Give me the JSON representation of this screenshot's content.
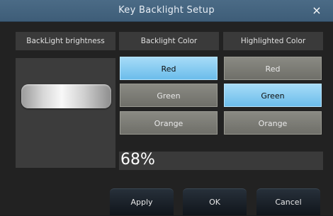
{
  "window": {
    "title": "Key Backlight Setup",
    "close_glyph": "×"
  },
  "columns": {
    "brightness": "BackLight brightness",
    "backlight_color": "Backlight Color",
    "highlighted_color": "Highlighted Color"
  },
  "brightness": {
    "percent_text": "68%",
    "value_percent": 68
  },
  "backlight_options": [
    {
      "label": "Red",
      "selected": true
    },
    {
      "label": "Green",
      "selected": false
    },
    {
      "label": "Orange",
      "selected": false
    }
  ],
  "highlighted_options": [
    {
      "label": "Red",
      "selected": false
    },
    {
      "label": "Green",
      "selected": true
    },
    {
      "label": "Orange",
      "selected": false
    }
  ],
  "buttons": {
    "apply": "Apply",
    "ok": "OK",
    "cancel": "Cancel"
  },
  "colors": {
    "titlebar": "#43627e",
    "selected_option": "#8fd0f3",
    "unselected_option": "#7e7e78",
    "background": "#222222"
  }
}
